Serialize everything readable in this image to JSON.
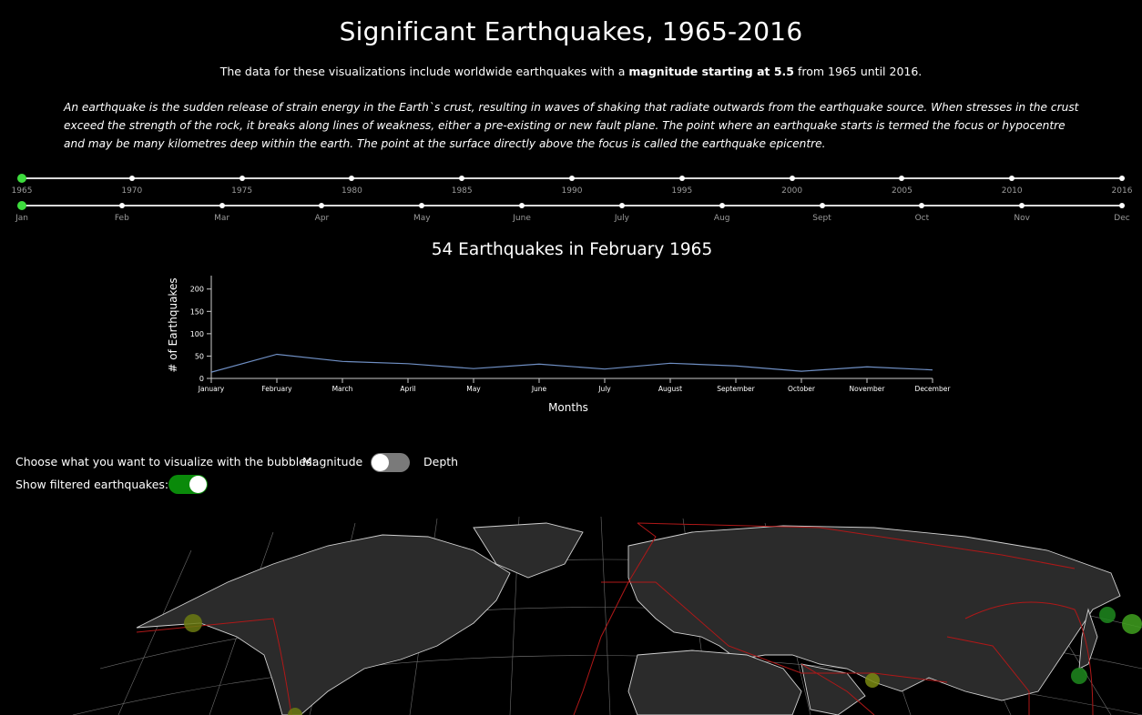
{
  "header": {
    "title": "Significant Earthquakes, 1965-2016",
    "subtitle_pre": "The data for these visualizations include worldwide earthquakes with a ",
    "subtitle_bold": "magnitude starting at 5.5",
    "subtitle_post": " from 1965 until 2016.",
    "intro": "An earthquake is the sudden release of strain energy in the Earth`s crust, resulting in waves of shaking that radiate outwards from the earthquake source. When stresses in the crust exceed the strength of the rock, it breaks along lines of weakness, either a pre-existing or new fault plane. The point where an earthquake starts is termed the focus or hypocentre and may be many kilometres deep within the earth. The point at the surface directly above the focus is called the earthquake epicentre."
  },
  "year_slider": {
    "labels": [
      "1965",
      "1970",
      "1975",
      "1980",
      "1985",
      "1990",
      "1995",
      "2000",
      "2005",
      "2010",
      "2016"
    ],
    "selected": "1965"
  },
  "month_slider": {
    "labels": [
      "Jan",
      "Feb",
      "Mar",
      "Apr",
      "May",
      "June",
      "July",
      "Aug",
      "Sept",
      "Oct",
      "Nov",
      "Dec"
    ],
    "selected": "Jan"
  },
  "chart": {
    "heading": "54 Earthquakes in February 1965"
  },
  "chart_data": {
    "type": "line",
    "categories": [
      "January",
      "February",
      "March",
      "April",
      "May",
      "June",
      "July",
      "August",
      "September",
      "October",
      "November",
      "December"
    ],
    "series": [
      {
        "values": [
          14,
          54,
          38,
          33,
          22,
          32,
          21,
          34,
          28,
          16,
          26,
          19
        ]
      }
    ],
    "xlabel": "Months",
    "ylabel": "# of Earthquakes",
    "ylim": [
      0,
      230
    ],
    "yticks": [
      0,
      50,
      100,
      150,
      200
    ],
    "grid": false,
    "line_color": "#6f8fc4"
  },
  "controls": {
    "bubble_prompt": "Choose what you want to visualize with the bubbles:",
    "magnitude_label": "Magnitude",
    "depth_label": "Depth",
    "bubble_toggle_on": false,
    "filtered_label": "Show filtered earthquakes:",
    "filtered_toggle_on": true,
    "toggle_on_color": "#0a8a0a",
    "toggle_off_color": "#7a7a7a"
  },
  "map": {
    "land_color": "#2b2b2b",
    "plate_boundary_color": "#b01818",
    "magnitude_bubble_color": "#6b7a12",
    "depth_bubble_color": "#1f8a1f"
  }
}
